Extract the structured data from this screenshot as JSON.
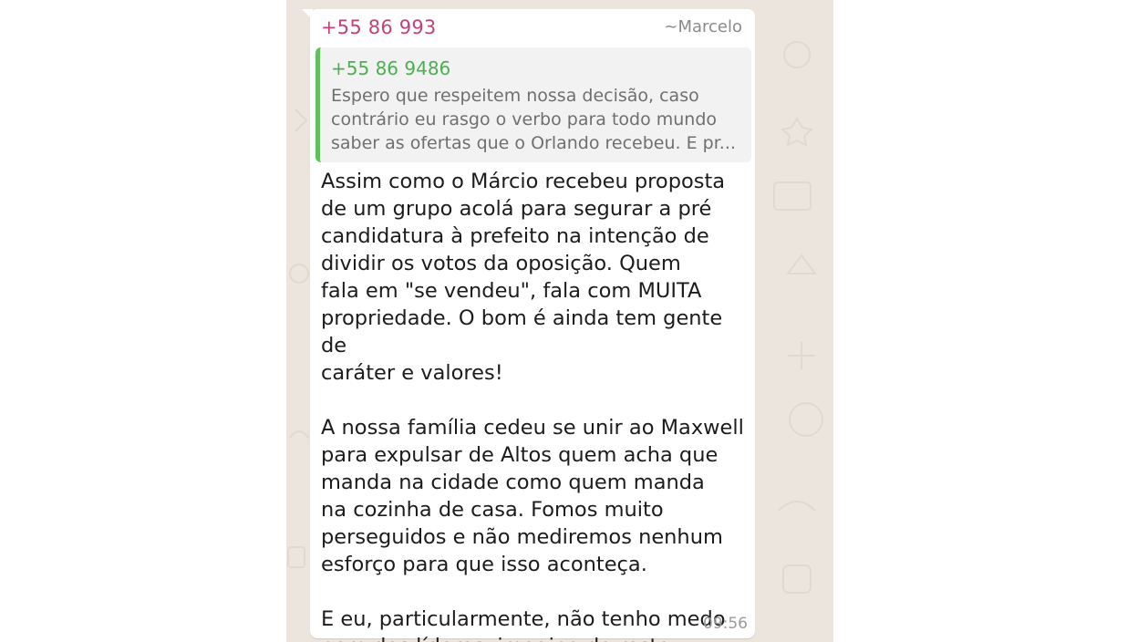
{
  "message": {
    "sender_number": "+55 86 993",
    "sender_name": "~Marcelo",
    "quoted": {
      "number": "+55 86 9486",
      "text": "Espero que respeitem nossa decisão, caso\ncontrário eu rasgo o verbo para todo mundo\nsaber as ofertas que o Orlando recebeu. E pr..."
    },
    "paragraphs": [
      "Assim como o Márcio recebeu proposta\nde um grupo acolá para segurar a pré\ncandidatura à prefeito na intenção de\ndividir os votos da oposição. Quem\nfala em \"se vendeu\", fala com MUITA\npropriedade. O bom é ainda tem gente de\ncaráter e valores!",
      "A nossa família cedeu se unir ao Maxwell\npara expulsar de Altos quem acha que\nmanda na cidade como quem manda\nna cozinha de casa. Fomos muito\nperseguidos e não mediremos nenhum\nesforço para que isso aconteça.",
      "E eu, particularmente, não tenho medo\nnem dos líderes, imagina do resto."
    ],
    "time": "09:56"
  },
  "colors": {
    "chat_background": "#ece5dd",
    "sender_number": "#c2427a",
    "quote_accent": "#5fc15a"
  }
}
